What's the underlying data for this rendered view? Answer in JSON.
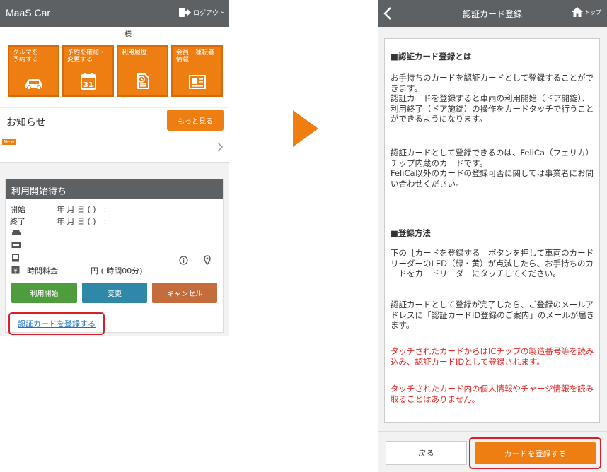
{
  "left_screen": {
    "header": {
      "title": "MaaS Car",
      "logout_label": "ログアウト"
    },
    "user_suffix": "様",
    "tiles": [
      {
        "label": "クルマを\n予約する",
        "icon": "car-icon"
      },
      {
        "label": "予約を確認・\n変更する",
        "icon": "calendar-icon",
        "icon_text": "31"
      },
      {
        "label": "利用履歴",
        "icon": "history-icon"
      },
      {
        "label": "会員・運転者\n情報",
        "icon": "id-card-icon"
      }
    ],
    "news": {
      "title": "お知らせ",
      "more_label": "もっと見る",
      "new_badge": "New"
    },
    "reservation": {
      "header": "利用開始待ち",
      "start_label": "開始",
      "start_value": "年 月 日 ( )　:",
      "end_label": "終了",
      "end_value": "年 月 日 ( )　:",
      "fee_label": "時間料金",
      "fee_value": "円 ( 時間00分)",
      "buttons": {
        "start": "利用開始",
        "change": "変更",
        "cancel": "キャンセル"
      },
      "register_link": "認証カードを登録する"
    }
  },
  "right_screen": {
    "header": {
      "title": "認証カード登録",
      "top_label": "トップ"
    },
    "sections": {
      "about_heading": "■認証カード登録とは",
      "about_p1": "お手持ちのカードを認証カードとして登録することができます。",
      "about_p2": "認証カードを登録すると車両の利用開始（ドア開錠）、利用終了（ドア施錠）の操作をカードタッチで行うことができるようになります。",
      "about_p3": "認証カードとして登録できるのは、FeliCa（フェリカ）チップ内蔵のカードです。",
      "about_p4": "FeliCa以外のカードの登録可否に関しては事業者にお問い合わせください。",
      "method_heading": "■登録方法",
      "method_p1": "下の［カードを登録する］ボタンを押して車両のカードリーダーのLED（緑・黄）が点滅したら、お手持ちのカードをカードリーダーにタッチしてください。",
      "method_p2": "認証カードとして登録が完了したら、ご登録のメールアドレスに「認証カードID登録のご案内」のメールが届きます。",
      "warn_p1": "タッチされたカードからはICチップの製造番号等を読み込み、認証カードIDとして登録されます。",
      "warn_p2": "タッチされたカード内の個人情報やチャージ情報を読み取ることはありません。"
    },
    "footer": {
      "back_label": "戻る",
      "register_label": "カードを登録する"
    }
  },
  "colors": {
    "orange": "#ee7d12",
    "header_gray": "#5d6163",
    "highlight_red": "#d81e2a",
    "warning_red": "#e32626",
    "link_blue": "#1a73c5"
  }
}
